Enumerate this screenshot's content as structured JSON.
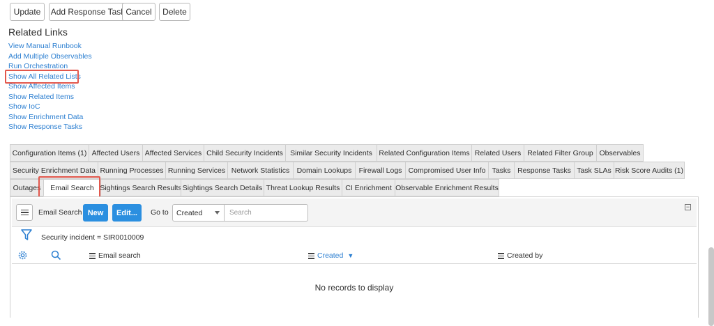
{
  "toolbar": {
    "update_label": "Update",
    "add_response_task_label": "Add Response Task",
    "cancel_label": "Cancel",
    "delete_label": "Delete"
  },
  "related_links": {
    "title": "Related Links",
    "items": [
      "View Manual Runbook",
      "Add Multiple Observables",
      "Run Orchestration",
      "Show All Related Lists",
      "Show Affected Items",
      "Show Related Items",
      "Show IoC",
      "Show Enrichment Data",
      "Show Response Tasks"
    ]
  },
  "tabs": {
    "row1": [
      "Configuration Items (1)",
      "Affected Users",
      "Affected Services",
      "Child Security Incidents",
      "Similar Security Incidents",
      "Related Configuration Items",
      "Related Users",
      "Related Filter Group",
      "Observables"
    ],
    "row2": [
      "Security Enrichment Data",
      "Running Processes",
      "Running Services",
      "Network Statistics",
      "Domain Lookups",
      "Firewall Logs",
      "Compromised User Info",
      "Tasks",
      "Response Tasks",
      "Task SLAs",
      "Risk Score Audits (1)"
    ],
    "row3": [
      "Outages",
      "Email Search",
      "Sightings Search Results",
      "Sightings Search Details",
      "Threat Lookup Results",
      "CI Enrichment",
      "Observable Enrichment Results"
    ],
    "active": "Email Search"
  },
  "list": {
    "title": "Email Search",
    "new_label": "New",
    "edit_label": "Edit...",
    "goto_label": "Go to",
    "goto_selected": "Created",
    "search_placeholder": "Search",
    "collapse_glyph": "−",
    "filter_text": "Security incident = SIR0010009",
    "columns": [
      "Email search",
      "Created",
      "Created by"
    ],
    "sort_indicator": "▼",
    "empty_message": "No records to display"
  },
  "colors": {
    "link": "#2c7fd1",
    "primary_button": "#2b8fe0",
    "highlight": "#e2574c"
  }
}
